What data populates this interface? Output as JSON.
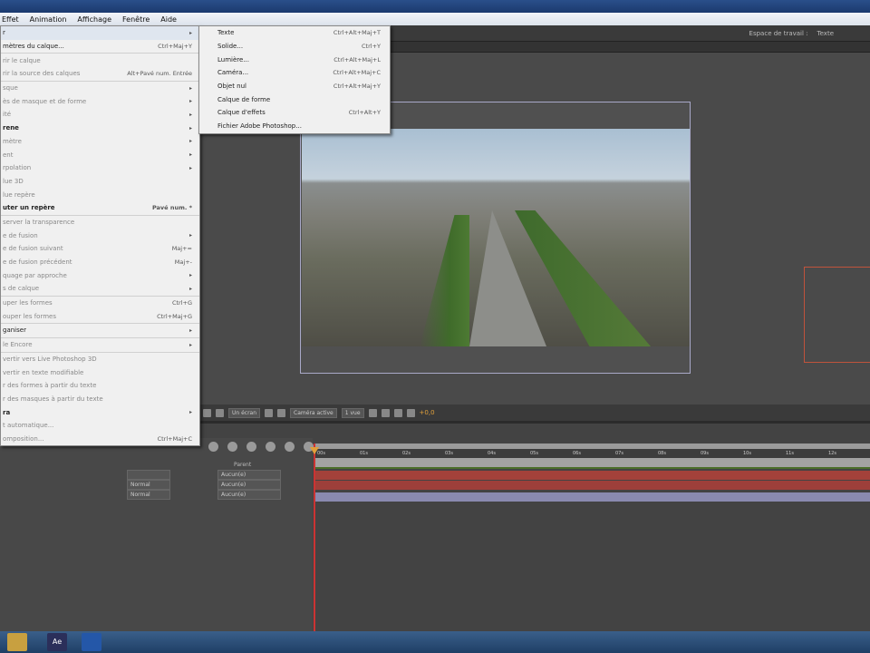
{
  "menubar": [
    "Effet",
    "Animation",
    "Affichage",
    "Fenêtre",
    "Aide"
  ],
  "workspace": {
    "label": "Espace de travail :",
    "value": "Texte"
  },
  "layer_menu": [
    {
      "label": "r",
      "shortcut": "",
      "arrow": true,
      "hl": true
    },
    {
      "label": "mètres du calque...",
      "shortcut": "Ctrl+Maj+Y"
    },
    {
      "sep": true
    },
    {
      "label": "rir le calque",
      "dis": true
    },
    {
      "label": "rir la source des calques",
      "shortcut": "Alt+Pavé num. Entrée",
      "dis": true
    },
    {
      "sep": true
    },
    {
      "label": "sque",
      "arrow": true,
      "dis": true
    },
    {
      "label": "ès de masque et de forme",
      "arrow": true,
      "dis": true
    },
    {
      "label": "ité",
      "arrow": true,
      "dis": true
    },
    {
      "label": "rene",
      "arrow": true,
      "bold": true
    },
    {
      "label": "mètre",
      "arrow": true,
      "dis": true
    },
    {
      "label": "ent",
      "arrow": true,
      "dis": true
    },
    {
      "label": "rpolation",
      "arrow": true,
      "dis": true
    },
    {
      "label": "lue 3D",
      "dis": true
    },
    {
      "label": "lue repère",
      "dis": true
    },
    {
      "label": "uter un repère",
      "shortcut": "Pavé num. *",
      "bold": true
    },
    {
      "sep": true
    },
    {
      "label": "server la transparence",
      "dis": true
    },
    {
      "label": "e de fusion",
      "arrow": true,
      "dis": true
    },
    {
      "label": "e de fusion suivant",
      "shortcut": "Maj+=",
      "dis": true
    },
    {
      "label": "e de fusion précédent",
      "shortcut": "Maj+-",
      "dis": true
    },
    {
      "label": "quage par approche",
      "arrow": true,
      "dis": true
    },
    {
      "label": "s de calque",
      "arrow": true,
      "dis": true
    },
    {
      "sep": true
    },
    {
      "label": "uper les formes",
      "shortcut": "Ctrl+G",
      "dis": true
    },
    {
      "label": "ouper les formes",
      "shortcut": "Ctrl+Maj+G",
      "dis": true
    },
    {
      "sep": true
    },
    {
      "label": "ganiser",
      "arrow": true
    },
    {
      "sep": true
    },
    {
      "label": "le Encore",
      "arrow": true,
      "dis": true
    },
    {
      "sep": true
    },
    {
      "label": "vertir vers Live Photoshop 3D",
      "dis": true
    },
    {
      "label": "vertir en texte modifiable",
      "dis": true
    },
    {
      "label": "r des formes à partir du texte",
      "dis": true
    },
    {
      "label": "r des masques à partir du texte",
      "dis": true
    },
    {
      "label": "ra",
      "arrow": true,
      "bold": true
    },
    {
      "label": "t automatique...",
      "dis": true
    },
    {
      "label": "omposition...",
      "shortcut": "Ctrl+Maj+C",
      "dis": true
    }
  ],
  "new_submenu": [
    {
      "label": "Texte",
      "shortcut": "Ctrl+Alt+Maj+T"
    },
    {
      "label": "Solide...",
      "shortcut": "Ctrl+Y"
    },
    {
      "label": "Lumière...",
      "shortcut": "Ctrl+Alt+Maj+L"
    },
    {
      "label": "Caméra...",
      "shortcut": "Ctrl+Alt+Maj+C"
    },
    {
      "label": "Objet nul",
      "shortcut": "Ctrl+Alt+Maj+Y"
    },
    {
      "label": "Calque de forme",
      "shortcut": ""
    },
    {
      "label": "Calque d'effets",
      "shortcut": "Ctrl+Alt+Y"
    },
    {
      "label": "Fichier Adobe Photoshop...",
      "shortcut": ""
    }
  ],
  "comp_toolbar": {
    "view": "Un écran",
    "camera": "Caméra active",
    "quality": "1 vue",
    "exposure": "+0,0"
  },
  "timeline": {
    "ticks": [
      "00s",
      "01s",
      "02s",
      "03s",
      "04s",
      "05s",
      "06s",
      "07s",
      "08s",
      "09s",
      "10s",
      "11s",
      "12s"
    ],
    "parent_header": "Parent",
    "layers": [
      {
        "mode": "",
        "parent": "Aucun(e)"
      },
      {
        "mode": "Normal",
        "parent": "Aucun(e)"
      },
      {
        "mode": "Normal",
        "parent": "Aucun(e)"
      }
    ]
  },
  "taskbar": {
    "ae": "Ae"
  },
  "colors": {
    "layer_red": "#a0403a",
    "layer_purple": "#8a8ab0",
    "accent": "#e1a03b"
  }
}
